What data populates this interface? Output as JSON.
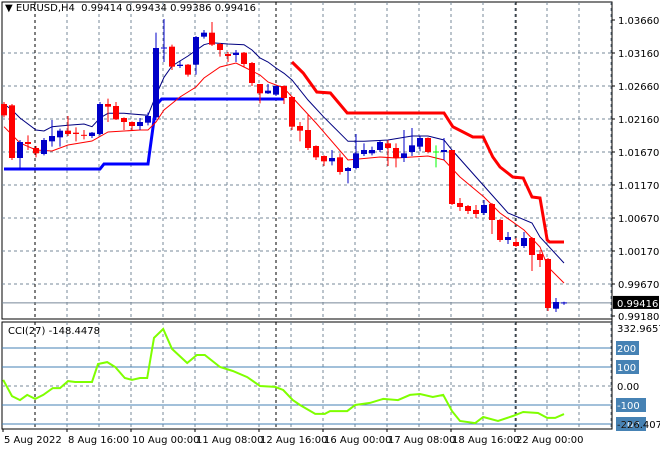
{
  "header": {
    "menu_icon": "triangle-down-icon",
    "symbol": "EURUSD,H4",
    "ohlc": "0.99414 0.99434 0.99386 0.99416"
  },
  "colors": {
    "bull": "#0000c8",
    "bear": "#ff0000",
    "doji": "#00ff00",
    "ma_fast": "#ff0000",
    "ma_slow": "#000080",
    "support_line": "#0000ff",
    "resistance_line": "#ff0000",
    "cci_line": "#7fff00",
    "cci_levels": "#4682b4",
    "grid": "#778899"
  },
  "price_axis": {
    "ticks": [
      "1.03660",
      "1.03160",
      "1.02660",
      "1.02160",
      "1.01670",
      "1.01170",
      "1.00670",
      "1.00170",
      "0.99670",
      "0.99180"
    ],
    "current_price": "0.99416"
  },
  "time_axis": {
    "labels": [
      "5 Aug 2022",
      "8 Aug 16:00",
      "10 Aug 00:00",
      "11 Aug 08:00",
      "12 Aug 16:00",
      "16 Aug 00:00",
      "17 Aug 08:00",
      "18 Aug 16:00",
      "22 Aug 00:00"
    ]
  },
  "candles": [
    [
      1.024,
      1.0243,
      1.022,
      1.0223
    ],
    [
      1.0238,
      1.024,
      1.0156,
      1.0159
    ],
    [
      1.0159,
      1.0186,
      1.0142,
      1.0183
    ],
    [
      1.0183,
      1.0193,
      1.0171,
      1.018
    ],
    [
      1.0174,
      1.0177,
      1.016,
      1.0166
    ],
    [
      1.0165,
      1.0189,
      1.0163,
      1.0186
    ],
    [
      1.0184,
      1.0216,
      1.0176,
      1.0192
    ],
    [
      1.019,
      1.0203,
      1.0176,
      1.02
    ],
    [
      1.02,
      1.0222,
      1.0192,
      1.0195
    ],
    [
      1.0197,
      1.0205,
      1.0184,
      1.0195
    ],
    [
      1.0193,
      1.0201,
      1.0187,
      1.0192
    ],
    [
      1.0192,
      1.0198,
      1.0189,
      1.0197
    ],
    [
      1.0195,
      1.0243,
      1.0193,
      1.024
    ],
    [
      1.024,
      1.0248,
      1.0213,
      1.0236
    ],
    [
      1.0237,
      1.0243,
      1.0216,
      1.0217
    ],
    [
      1.0219,
      1.022,
      1.0201,
      1.0213
    ],
    [
      1.0213,
      1.0214,
      1.0201,
      1.0207
    ],
    [
      1.0207,
      1.0219,
      1.0201,
      1.0213
    ],
    [
      1.0212,
      1.0227,
      1.0208,
      1.0222
    ],
    [
      1.022,
      1.0347,
      1.0216,
      1.0324
    ],
    [
      1.0323,
      1.03675,
      1.0303,
      1.0324
    ],
    [
      1.0326,
      1.0329,
      1.0291,
      1.0296
    ],
    [
      1.0297,
      1.0305,
      1.0294,
      1.0299
    ],
    [
      1.0299,
      1.03,
      1.0281,
      1.0284
    ],
    [
      1.0299,
      1.0342,
      1.0284,
      1.03405
    ],
    [
      1.0341,
      1.0351,
      1.0338,
      1.0347
    ],
    [
      1.0347,
      1.0363,
      1.0327,
      1.0329
    ],
    [
      1.033,
      1.03315,
      1.0311,
      1.0321
    ],
    [
      1.0315,
      1.0318,
      1.0303,
      1.0312
    ],
    [
      1.03135,
      1.0321,
      1.0303,
      1.0317
    ],
    [
      1.0317,
      1.0318,
      1.0296,
      1.03
    ],
    [
      1.03015,
      1.0303,
      1.0267,
      1.02715
    ],
    [
      1.027,
      1.027,
      1.0241,
      1.0256
    ],
    [
      1.0256,
      1.027,
      1.0255,
      1.026
    ],
    [
      1.0254,
      1.0268,
      1.0252,
      1.0267
    ],
    [
      1.0267,
      1.0268,
      1.024,
      1.0249
    ],
    [
      1.02505,
      1.0252,
      1.0201,
      1.0206
    ],
    [
      1.0207,
      1.0213,
      1.0184,
      1.02
    ],
    [
      1.0201,
      1.0224,
      1.0171,
      1.0174
    ],
    [
      1.0177,
      1.0178,
      1.0156,
      1.016
    ],
    [
      1.0162,
      1.0163,
      1.0147,
      1.0154
    ],
    [
      1.0154,
      1.0171,
      1.0148,
      1.0159
    ],
    [
      1.016,
      1.0166,
      1.0134,
      1.0138
    ],
    [
      1.01395,
      1.01455,
      1.0121,
      1.0144
    ],
    [
      1.0144,
      1.0195,
      1.0142,
      1.0166
    ],
    [
      1.0165,
      1.0181,
      1.0162,
      1.0171
    ],
    [
      1.0166,
      1.0176,
      1.0163,
      1.0171
    ],
    [
      1.0171,
      1.0186,
      1.0168,
      1.0183
    ],
    [
      1.0181,
      1.0186,
      1.0147,
      1.0174
    ],
    [
      1.0174,
      1.0181,
      1.0145,
      1.0159
    ],
    [
      1.0159,
      1.0201,
      1.0153,
      1.0166
    ],
    [
      1.0168,
      1.0204,
      1.0162,
      1.0178
    ],
    [
      1.0176,
      1.0192,
      1.0169,
      1.0189
    ],
    [
      1.0189,
      1.019,
      1.0166,
      1.0168
    ],
    [
      1.0168,
      1.0178,
      1.0145,
      1.0168
    ],
    [
      1.0168,
      1.0189,
      1.0156,
      1.0171
    ],
    [
      1.0171,
      1.0171,
      1.00885,
      1.009
    ],
    [
      1.00915,
      1.0099,
      1.00795,
      1.00855
    ],
    [
      1.0087,
      1.00885,
      1.0075,
      1.00795
    ],
    [
      1.0081,
      1.00885,
      1.0069,
      1.0075
    ],
    [
      1.00765,
      1.0096,
      1.00735,
      1.00885
    ],
    [
      1.009,
      1.00915,
      1.0045,
      1.0066
    ],
    [
      1.0066,
      1.00675,
      1.0033,
      1.0036
    ],
    [
      1.0036,
      1.0048,
      1.003,
      1.00405
    ],
    [
      1.0033,
      1.0039,
      1.00255,
      1.0027
    ],
    [
      1.0027,
      1.0048,
      1.0024,
      1.0039
    ],
    [
      1.0039,
      1.00405,
      0.99895,
      1.00135
    ],
    [
      1.0015,
      1.0021,
      0.99955,
      1.0006
    ],
    [
      1.00075,
      1.0009,
      0.99295,
      0.9934
    ],
    [
      0.9933,
      0.9949,
      0.9928,
      0.9943
    ],
    [
      0.99414,
      0.99434,
      0.99386,
      0.99416
    ]
  ],
  "indicators": {
    "ma_slow": [
      [
        1,
        1.024
      ],
      [
        2,
        1.0231
      ],
      [
        3,
        1.0219
      ],
      [
        5,
        1.0201
      ],
      [
        6,
        1.01995
      ],
      [
        7,
        1.0206
      ],
      [
        9,
        1.0208
      ],
      [
        11,
        1.021
      ],
      [
        12,
        1.0206
      ],
      [
        13,
        1.0219
      ],
      [
        14,
        1.0226
      ],
      [
        16,
        1.0226
      ],
      [
        17,
        1.0225
      ],
      [
        19,
        1.0223
      ],
      [
        20,
        1.0253
      ],
      [
        21,
        1.028
      ],
      [
        22,
        1.0297
      ],
      [
        24,
        1.0312
      ],
      [
        26,
        1.0329
      ],
      [
        27,
        1.0332
      ],
      [
        29,
        1.033
      ],
      [
        31,
        1.0329
      ],
      [
        32,
        1.0321
      ],
      [
        33,
        1.0309
      ],
      [
        34,
        1.0303
      ],
      [
        35,
        1.0294
      ],
      [
        36,
        1.0286
      ],
      [
        37,
        1.0276
      ],
      [
        39,
        1.0246
      ],
      [
        41,
        1.022
      ],
      [
        44,
        1.0184
      ],
      [
        46,
        1.0184
      ],
      [
        49,
        1.0186
      ],
      [
        52,
        1.0192
      ],
      [
        54,
        1.0192
      ],
      [
        56,
        1.0186
      ],
      [
        57,
        1.0171
      ],
      [
        60,
        1.01305
      ],
      [
        64,
        1.00765
      ],
      [
        67,
        1.00615
      ],
      [
        68,
        1.00405
      ],
      [
        71,
        1.00015
      ]
    ],
    "ma_fast": [
      [
        1,
        1.0206
      ],
      [
        3,
        1.01815
      ],
      [
        5,
        1.0171
      ],
      [
        7,
        1.01695
      ],
      [
        9,
        1.01785
      ],
      [
        12,
        1.01845
      ],
      [
        14,
        1.0198
      ],
      [
        16,
        1.01995
      ],
      [
        18,
        1.0201
      ],
      [
        19,
        1.0201
      ],
      [
        20,
        1.0213
      ],
      [
        21,
        1.0231
      ],
      [
        23,
        1.02505
      ],
      [
        25,
        1.02655
      ],
      [
        26,
        1.0279
      ],
      [
        28,
        1.02955
      ],
      [
        30,
        1.03015
      ],
      [
        31,
        1.02955
      ],
      [
        33,
        1.02835
      ],
      [
        34,
        1.0273
      ],
      [
        36,
        1.0264
      ],
      [
        37,
        1.02505
      ],
      [
        40,
        1.02115
      ],
      [
        44,
        1.0156
      ],
      [
        48,
        1.01605
      ],
      [
        50,
        1.0159
      ],
      [
        54,
        1.0162
      ],
      [
        56,
        1.0156
      ],
      [
        58,
        1.01305
      ],
      [
        61,
        1.01005
      ],
      [
        63,
        1.00765
      ],
      [
        66,
        1.0051
      ],
      [
        68,
        1.00255
      ],
      [
        69,
        0.99955
      ],
      [
        71,
        0.99715
      ]
    ],
    "support_line": [
      [
        1,
        1.01425
      ],
      [
        13,
        1.01425
      ],
      [
        13.5,
        1.015
      ],
      [
        19,
        1.015
      ],
      [
        20,
        1.0238
      ],
      [
        20.7,
        1.02475
      ],
      [
        36,
        1.02475
      ]
    ],
    "resistance_line": [
      [
        37,
        1.0303
      ],
      [
        38.4,
        1.02865
      ],
      [
        40.1,
        1.0258
      ],
      [
        41.8,
        1.02565
      ],
      [
        43.9,
        1.02265
      ],
      [
        56,
        1.02265
      ],
      [
        57.1,
        1.0206
      ],
      [
        59.6,
        1.01905
      ],
      [
        60.9,
        1.01905
      ],
      [
        62.1,
        1.01605
      ],
      [
        63,
        1.01455
      ],
      [
        64.6,
        1.01305
      ],
      [
        65.9,
        1.0129
      ],
      [
        67,
        1.01005
      ],
      [
        68,
        1.0099
      ],
      [
        68.9,
        1.0036
      ],
      [
        69.2,
        1.0033
      ],
      [
        71,
        1.0033
      ]
    ]
  },
  "cci": {
    "label": "CCI(27) -148.4478",
    "scale_max": "332.9657",
    "scale_min": "-226.4073",
    "levels": [
      "200",
      "100",
      "0.00",
      "-100",
      "-200"
    ],
    "values": [
      [
        0.9,
        32
      ],
      [
        2,
        -53
      ],
      [
        3,
        -74
      ],
      [
        3.9,
        -47
      ],
      [
        4.9,
        -68
      ],
      [
        5.9,
        -47
      ],
      [
        7.1,
        -11
      ],
      [
        8,
        -11
      ],
      [
        9,
        26
      ],
      [
        9.9,
        21
      ],
      [
        12,
        21
      ],
      [
        12.75,
        116
      ],
      [
        13.9,
        126
      ],
      [
        14.9,
        100
      ],
      [
        16.1,
        42
      ],
      [
        17,
        32
      ],
      [
        18,
        42
      ],
      [
        18.9,
        42
      ],
      [
        19.75,
        253
      ],
      [
        20.9,
        300
      ],
      [
        22,
        195
      ],
      [
        23.9,
        121
      ],
      [
        25.1,
        163
      ],
      [
        26.1,
        163
      ],
      [
        28,
        100
      ],
      [
        29.6,
        79
      ],
      [
        31.4,
        47
      ],
      [
        33,
        0
      ],
      [
        34.9,
        -5
      ],
      [
        35.9,
        -21
      ],
      [
        37.1,
        -74
      ],
      [
        38,
        -100
      ],
      [
        39.9,
        -147
      ],
      [
        41.1,
        -147
      ],
      [
        41.75,
        -132
      ],
      [
        43.9,
        -132
      ],
      [
        44.9,
        -100
      ],
      [
        46.75,
        -89
      ],
      [
        48.4,
        -68
      ],
      [
        50.25,
        -74
      ],
      [
        51.75,
        -47
      ],
      [
        53,
        -42
      ],
      [
        54.6,
        -58
      ],
      [
        55.9,
        -47
      ],
      [
        57,
        -132
      ],
      [
        58,
        -184
      ],
      [
        59.9,
        -195
      ],
      [
        60.9,
        -163
      ],
      [
        62.75,
        -184
      ],
      [
        64.6,
        -158
      ],
      [
        65.9,
        -137
      ],
      [
        67.75,
        -142
      ],
      [
        68.9,
        -168
      ],
      [
        69.9,
        -168
      ],
      [
        71,
        -148
      ]
    ]
  }
}
